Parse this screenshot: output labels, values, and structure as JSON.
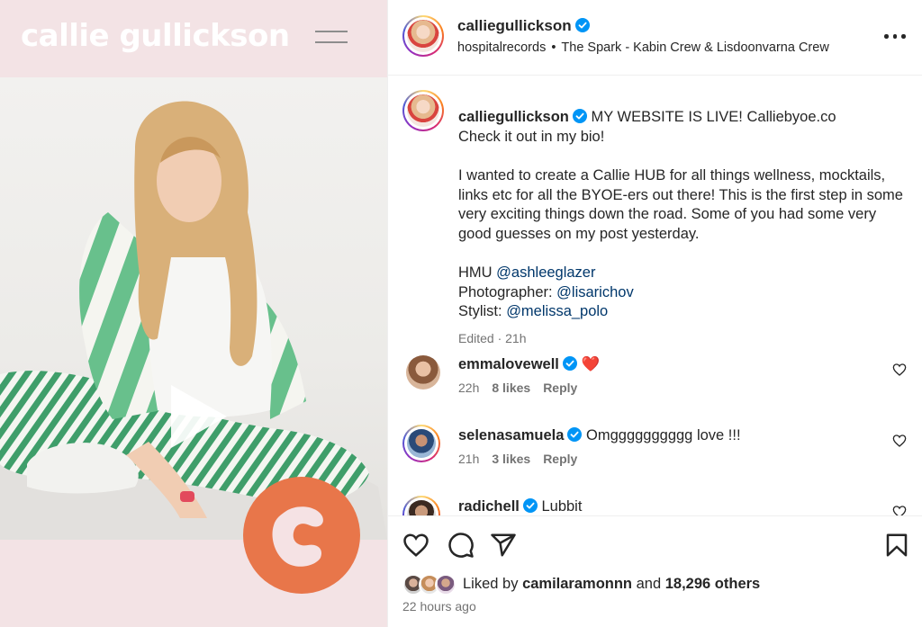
{
  "media": {
    "brand": "callie gullickson",
    "colors": {
      "background": "#f3e3e5",
      "badge": "#e8764a"
    }
  },
  "header": {
    "username": "calliegullickson",
    "audio_source": "hospitalrecords",
    "separator": "•",
    "audio_track": "The Spark - Kabin Crew & Lisdoonvarna Crew"
  },
  "caption": {
    "username": "calliegullickson",
    "line1": "MY WEBSITE IS LIVE! Calliebyoe.co",
    "line2": "Check it out in my bio!",
    "paragraph": "I wanted to create a Callie HUB for all things wellness, mocktails, links etc for all the BYOE-ers out there! This is the first step in some very exciting things down the road. Some of you had some very good guesses on my post yesterday.",
    "credits": [
      {
        "label": "HMU",
        "mention": "@ashleeglazer"
      },
      {
        "label": "Photographer:",
        "mention": "@lisarichov"
      },
      {
        "label": "Stylist:",
        "mention": "@melissa_polo"
      }
    ],
    "meta": "Edited · 21h"
  },
  "comments": [
    {
      "username": "emmalovewell",
      "text": "❤️",
      "time": "22h",
      "likes": "8 likes",
      "reply": "Reply"
    },
    {
      "username": "selenasamuela",
      "text": "Omgggggggggg love !!!",
      "time": "21h",
      "likes": "3 likes",
      "reply": "Reply"
    },
    {
      "username": "radichell",
      "text": "Lubbit",
      "time": "",
      "likes": "",
      "reply": ""
    }
  ],
  "likes": {
    "prefix": "Liked by",
    "user": "camilaramonnn",
    "and": "and",
    "others": "18,296 others"
  },
  "timestamp": "22 hours ago",
  "icons": [
    "play-icon",
    "more-icon",
    "verified-icon",
    "heart-icon",
    "comment-icon",
    "share-icon",
    "bookmark-icon"
  ],
  "colors": {
    "verified": "#0095f6",
    "mention": "#00376b",
    "secondary_text": "#737373"
  }
}
